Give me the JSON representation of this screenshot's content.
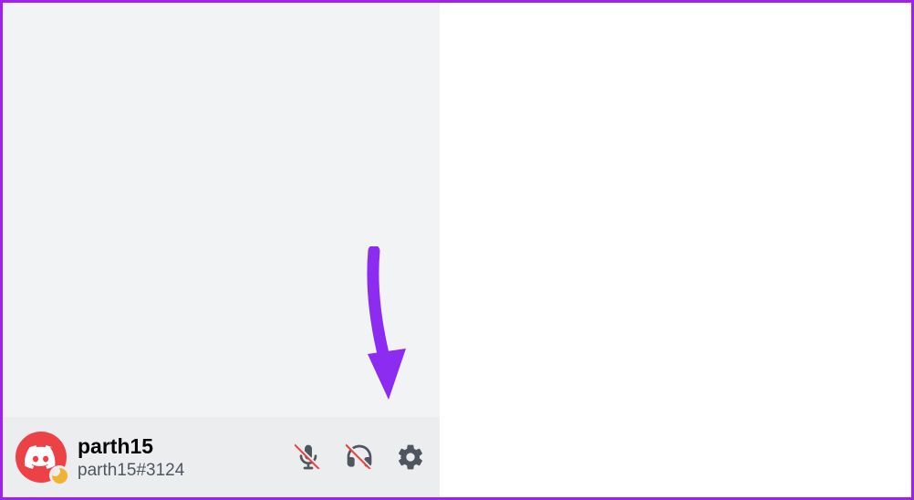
{
  "user": {
    "name": "parth15",
    "tag": "parth15#3124",
    "status": "idle"
  },
  "controls": {
    "mic": "muted",
    "headset": "deafened",
    "settings": "User Settings"
  },
  "annotation": {
    "color": "#8c2cf0",
    "target": "settings-button"
  }
}
